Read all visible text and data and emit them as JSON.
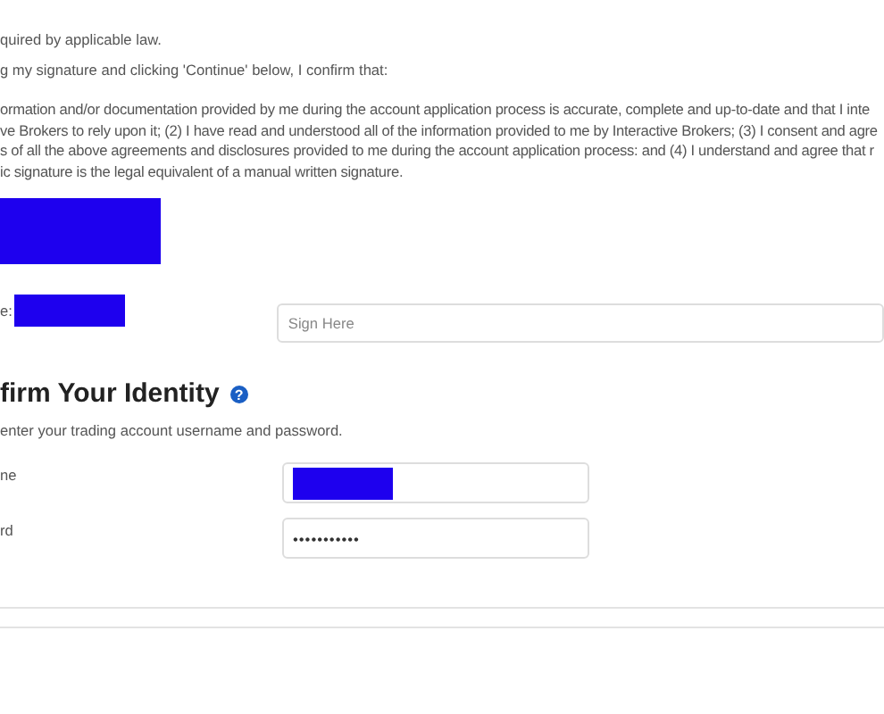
{
  "intro_lines": [
    "quired by applicable law.",
    "g my signature and clicking 'Continue' below, I confirm that:"
  ],
  "statement_lines": [
    "ormation and/or documentation provided by me during the account application process is accurate, complete and up-to-date and that I inte",
    "ve Brokers to rely upon it; (2) I have read and understood all of the information provided to me by Interactive Brokers; (3) I consent and agre",
    "s of all the above agreements and disclosures provided to me during the account application process: and (4) I understand and agree that r",
    "ic signature is the legal equivalent of a manual written signature."
  ],
  "signature": {
    "label": "e:",
    "placeholder": "Sign Here"
  },
  "identity": {
    "heading": "firm Your Identity",
    "help_icon": "?",
    "description": "enter your trading account username and password.",
    "fields": [
      {
        "label": "ne",
        "kind": "redacted"
      },
      {
        "label": "rd",
        "kind": "password",
        "value": "•••••••••••"
      }
    ]
  }
}
